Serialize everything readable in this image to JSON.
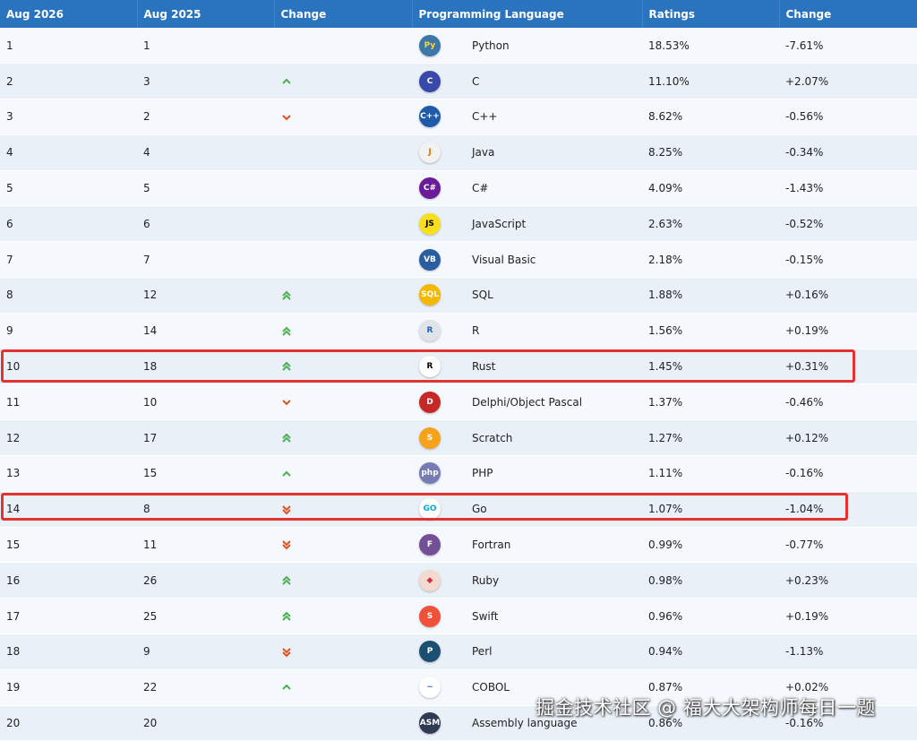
{
  "header": {
    "rank_now": "Aug 2026",
    "rank_prev": "Aug 2025",
    "change": "Change",
    "language": "Programming Language",
    "ratings": "Ratings",
    "ratings_change": "Change"
  },
  "rows": [
    {
      "rank": "1",
      "prev": "1",
      "trend": "none",
      "name": "Python",
      "rating": "18.53%",
      "change": "-7.61%",
      "icon": {
        "name": "python-icon",
        "label": "Py",
        "bg": "#3b77a8",
        "fg": "#ffd43b"
      }
    },
    {
      "rank": "2",
      "prev": "3",
      "trend": "up",
      "name": "C",
      "rating": "11.10%",
      "change": "+2.07%",
      "icon": {
        "name": "c-icon",
        "label": "C",
        "bg": "#3949ab",
        "fg": "#ffffff"
      }
    },
    {
      "rank": "3",
      "prev": "2",
      "trend": "down",
      "name": "C++",
      "rating": "8.62%",
      "change": "-0.56%",
      "icon": {
        "name": "cpp-icon",
        "label": "C++",
        "bg": "#1e5aa8",
        "fg": "#ffffff"
      }
    },
    {
      "rank": "4",
      "prev": "4",
      "trend": "none",
      "name": "Java",
      "rating": "8.25%",
      "change": "-0.34%",
      "icon": {
        "name": "java-icon",
        "label": "J",
        "bg": "#f2f2f2",
        "fg": "#e76f00"
      }
    },
    {
      "rank": "5",
      "prev": "5",
      "trend": "none",
      "name": "C#",
      "rating": "4.09%",
      "change": "-1.43%",
      "icon": {
        "name": "csharp-icon",
        "label": "C#",
        "bg": "#6a1b9a",
        "fg": "#ffffff"
      }
    },
    {
      "rank": "6",
      "prev": "6",
      "trend": "none",
      "name": "JavaScript",
      "rating": "2.63%",
      "change": "-0.52%",
      "icon": {
        "name": "javascript-icon",
        "label": "JS",
        "bg": "#f7df1e",
        "fg": "#000000"
      }
    },
    {
      "rank": "7",
      "prev": "7",
      "trend": "none",
      "name": "Visual Basic",
      "rating": "2.18%",
      "change": "-0.15%",
      "icon": {
        "name": "visual-basic-icon",
        "label": "VB",
        "bg": "#2a5d9f",
        "fg": "#ffffff"
      }
    },
    {
      "rank": "8",
      "prev": "12",
      "trend": "double-up",
      "name": "SQL",
      "rating": "1.88%",
      "change": "+0.16%",
      "icon": {
        "name": "sql-icon",
        "label": "SQL",
        "bg": "#f5b800",
        "fg": "#ffffff"
      }
    },
    {
      "rank": "9",
      "prev": "14",
      "trend": "double-up",
      "name": "R",
      "rating": "1.56%",
      "change": "+0.19%",
      "icon": {
        "name": "r-icon",
        "label": "R",
        "bg": "#dfe3ea",
        "fg": "#2166b0"
      }
    },
    {
      "rank": "10",
      "prev": "18",
      "trend": "double-up",
      "name": "Rust",
      "rating": "1.45%",
      "change": "+0.31%",
      "icon": {
        "name": "rust-icon",
        "label": "R",
        "bg": "#ffffff",
        "fg": "#000000"
      }
    },
    {
      "rank": "11",
      "prev": "10",
      "trend": "down",
      "name": "Delphi/Object Pascal",
      "rating": "1.37%",
      "change": "-0.46%",
      "icon": {
        "name": "delphi-icon",
        "label": "D",
        "bg": "#c62828",
        "fg": "#ffffff"
      }
    },
    {
      "rank": "12",
      "prev": "17",
      "trend": "double-up",
      "name": "Scratch",
      "rating": "1.27%",
      "change": "+0.12%",
      "icon": {
        "name": "scratch-icon",
        "label": "S",
        "bg": "#f7a21b",
        "fg": "#ffffff"
      }
    },
    {
      "rank": "13",
      "prev": "15",
      "trend": "up",
      "name": "PHP",
      "rating": "1.11%",
      "change": "-0.16%",
      "icon": {
        "name": "php-icon",
        "label": "php",
        "bg": "#777bb3",
        "fg": "#ffffff"
      }
    },
    {
      "rank": "14",
      "prev": "8",
      "trend": "double-down",
      "name": "Go",
      "rating": "1.07%",
      "change": "-1.04%",
      "icon": {
        "name": "go-icon",
        "label": "GO",
        "bg": "#ffffff",
        "fg": "#00add8"
      }
    },
    {
      "rank": "15",
      "prev": "11",
      "trend": "double-down",
      "name": "Fortran",
      "rating": "0.99%",
      "change": "-0.77%",
      "icon": {
        "name": "fortran-icon",
        "label": "F",
        "bg": "#734f96",
        "fg": "#ffffff"
      }
    },
    {
      "rank": "16",
      "prev": "26",
      "trend": "double-up",
      "name": "Ruby",
      "rating": "0.98%",
      "change": "+0.23%",
      "icon": {
        "name": "ruby-icon",
        "label": "◆",
        "bg": "#f3d9d0",
        "fg": "#cc342d"
      }
    },
    {
      "rank": "17",
      "prev": "25",
      "trend": "double-up",
      "name": "Swift",
      "rating": "0.96%",
      "change": "+0.19%",
      "icon": {
        "name": "swift-icon",
        "label": "S",
        "bg": "#f05138",
        "fg": "#ffffff"
      }
    },
    {
      "rank": "18",
      "prev": "9",
      "trend": "double-down",
      "name": "Perl",
      "rating": "0.94%",
      "change": "-1.13%",
      "icon": {
        "name": "perl-icon",
        "label": "P",
        "bg": "#1b4f72",
        "fg": "#ffffff"
      }
    },
    {
      "rank": "19",
      "prev": "22",
      "trend": "up",
      "name": "COBOL",
      "rating": "0.87%",
      "change": "+0.02%",
      "icon": {
        "name": "cobol-icon",
        "label": "~",
        "bg": "#ffffff",
        "fg": "#3a6fb0"
      }
    },
    {
      "rank": "20",
      "prev": "20",
      "trend": "none",
      "name": "Assembly language",
      "rating": "0.86%",
      "change": "-0.16%",
      "icon": {
        "name": "assembly-icon",
        "label": "ASM",
        "bg": "#2f3b52",
        "fg": "#ffffff"
      }
    }
  ],
  "highlighted_ranks": [
    "10",
    "14"
  ],
  "colors": {
    "header_bg": "#2a73bf",
    "arrow_up": "#4caf50",
    "arrow_down": "#e0501f",
    "highlight_border": "#e3322f"
  },
  "watermark": "掘金技术社区 @ 福大大架构师每日一题"
}
